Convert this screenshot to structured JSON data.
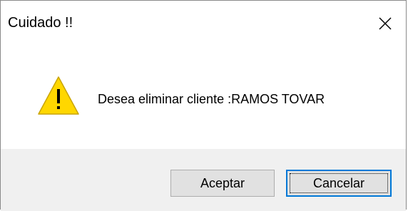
{
  "window": {
    "title": "Cuidado !!",
    "close_icon": "close-icon"
  },
  "message": {
    "icon": "warning-icon",
    "text": "Desea eliminar cliente :RAMOS TOVAR"
  },
  "buttons": {
    "ok_label": "Aceptar",
    "cancel_label": "Cancelar"
  },
  "colors": {
    "warning_fill": "#ffd700",
    "focus_border": "#0078d7",
    "footer_bg": "#f0f0f0"
  }
}
